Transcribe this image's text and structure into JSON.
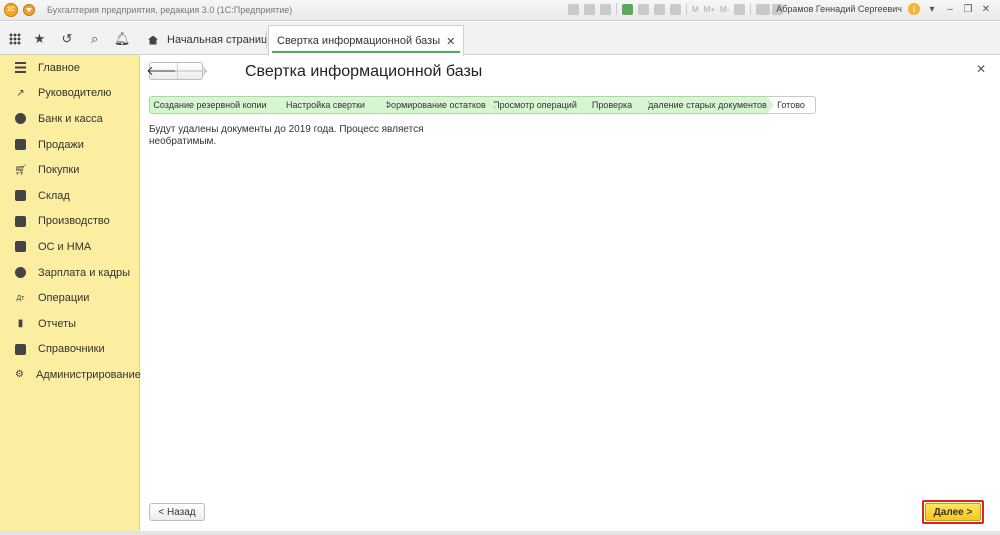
{
  "window": {
    "title": "Бухгалтерия предприятия, редакция 3.0  (1С:Предприятие)",
    "logo_text": "1С",
    "tool_labels": [
      "M",
      "M+",
      "M-"
    ],
    "user_name": "Абрамов Геннадий Сергеевич"
  },
  "tabs": [
    {
      "label": "Начальная страница"
    },
    {
      "label": "Свертка информационной базы"
    }
  ],
  "sidebar": {
    "items": [
      {
        "label": "Главное",
        "icon": "menu-lines-icon"
      },
      {
        "label": "Руководителю",
        "icon": "trend-icon"
      },
      {
        "label": "Банк и касса",
        "icon": "coin-icon"
      },
      {
        "label": "Продажи",
        "icon": "bag-icon"
      },
      {
        "label": "Покупки",
        "icon": "cart-icon"
      },
      {
        "label": "Склад",
        "icon": "warehouse-icon"
      },
      {
        "label": "Производство",
        "icon": "factory-icon"
      },
      {
        "label": "ОС и НМА",
        "icon": "truck-icon"
      },
      {
        "label": "Зарплата и кадры",
        "icon": "people-icon"
      },
      {
        "label": "Операции",
        "icon": "dt-kt-icon"
      },
      {
        "label": "Отчеты",
        "icon": "bar-chart-icon"
      },
      {
        "label": "Справочники",
        "icon": "books-icon"
      },
      {
        "label": "Администрирование",
        "icon": "gear-icon"
      }
    ]
  },
  "form": {
    "title": "Свертка информационной базы",
    "steps": [
      {
        "label": "Создание резервной копии",
        "state": "done"
      },
      {
        "label": "Настройка свертки",
        "state": "done"
      },
      {
        "label": "Формирование остатков",
        "state": "done"
      },
      {
        "label": "Просмотр операций",
        "state": "done"
      },
      {
        "label": "Проверка",
        "state": "done"
      },
      {
        "label": "Удаление старых документов",
        "state": "done"
      },
      {
        "label": "Готово",
        "state": "current"
      }
    ],
    "message_line1": "Будут удалены документы до 2019 года. Процесс является",
    "message_line2": "необратимым.",
    "back_label": "< Назад",
    "next_label": "Далее >"
  },
  "colors": {
    "sidebar_bg": "#fbeea0",
    "step_done": "#d8f5d2",
    "primary_button": "#f6c81e",
    "highlight": "#e0241b",
    "active_tab_underline": "#4caf50"
  }
}
